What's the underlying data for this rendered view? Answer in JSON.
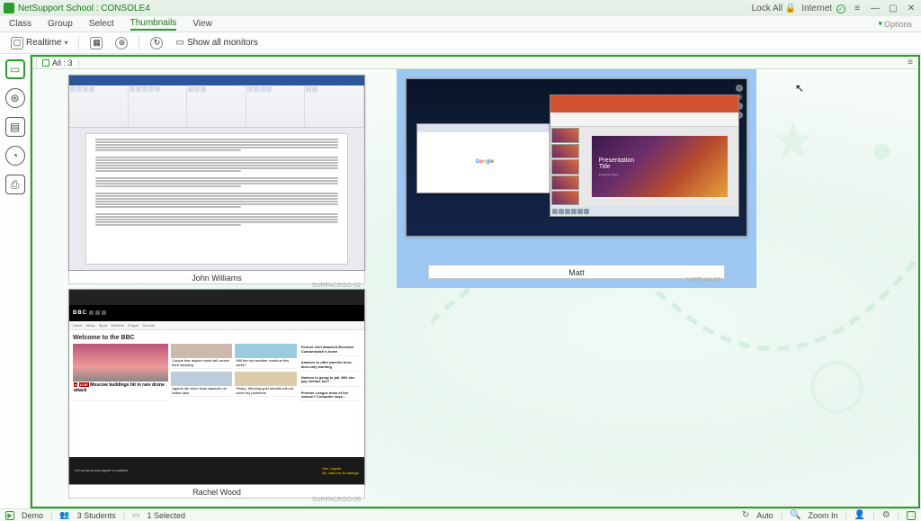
{
  "titlebar": {
    "app": "NetSupport School",
    "title": "CONSOLE4",
    "lock_all": "Lock All",
    "internet": "Internet",
    "options": "Options"
  },
  "menu": {
    "class": "Class",
    "group": "Group",
    "select": "Select",
    "thumbnails": "Thumbnails",
    "view": "View"
  },
  "toolbar": {
    "realtime": "Realtime",
    "show_all": "Show all monitors"
  },
  "tabs": {
    "all": "All : 3"
  },
  "students": [
    {
      "name": "John Williams",
      "device": "SURFACEGO-02"
    },
    {
      "name": "Matt",
      "device": "VIRTUAL03"
    },
    {
      "name": "Rachel Wood",
      "device": "SURFACEGO-06"
    }
  ],
  "thumb_content": {
    "bbc": {
      "logo": "BBC",
      "welcome": "Welcome to the BBC",
      "live_tag": "LIVE",
      "hero": "Moscow buildings hit in rare drone attack",
      "cards": [
        "Couple fear asylum hotel will cancel their wedding",
        "Will the hot weather continue this week?",
        "Agents die when boat capsizes on Italian lake",
        "Pesky: Winning gold medals will not solve my problems"
      ],
      "side": [
        "Former chef attacked Benedict Cumberbatch's home",
        "Amazon to offer parents term-time-only working",
        "Holmes is going to jail. Will she pay victims too?",
        "Premier League team of the season? Computer says..."
      ],
      "footer_left": "Let us know you agree to cookies",
      "footer_r1": "Yes, I agree",
      "footer_r2": "No, take me to settings"
    },
    "google": "Google",
    "ppt": {
      "title": "Presentation\nTitle",
      "subtitle": "Presenter Name"
    }
  },
  "status": {
    "demo": "Demo",
    "students": "3 Students",
    "selected": "1 Selected",
    "auto": "Auto",
    "zoom": "Zoom In"
  }
}
